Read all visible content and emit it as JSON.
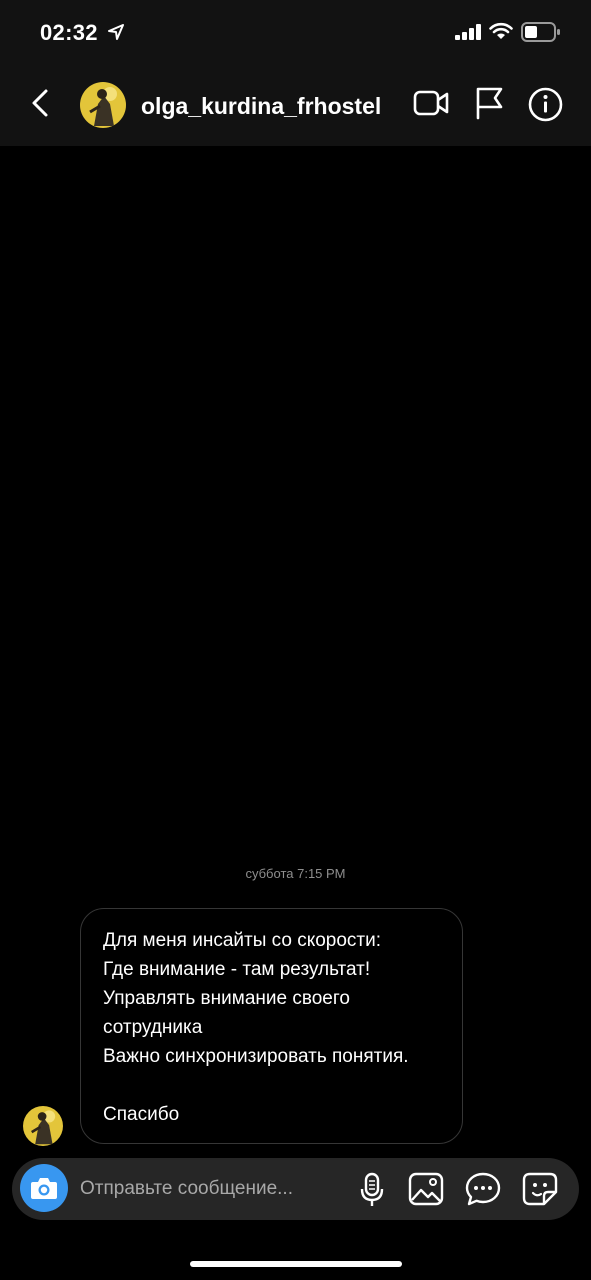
{
  "status_bar": {
    "time": "02:32"
  },
  "header": {
    "username": "olga_kurdina_frhostel",
    "icons": [
      "back-arrow-icon",
      "video-camera-icon",
      "flag-icon",
      "info-icon"
    ]
  },
  "conversation": {
    "timestamp": "суббота 7:15 PM",
    "message": {
      "lines": [
        "Для меня инсайты со скорости:",
        "Где внимание - там результат!",
        "Управлять внимание своего",
        "сотрудника",
        "Важно синхронизировать понятия.",
        "",
        "Спасибо"
      ]
    }
  },
  "composer": {
    "placeholder": "Отправьте сообщение...",
    "icons": [
      "camera-icon",
      "microphone-icon",
      "gallery-icon",
      "chat-bubble-icon",
      "sticker-icon"
    ],
    "accent_color": "#3897f0"
  }
}
